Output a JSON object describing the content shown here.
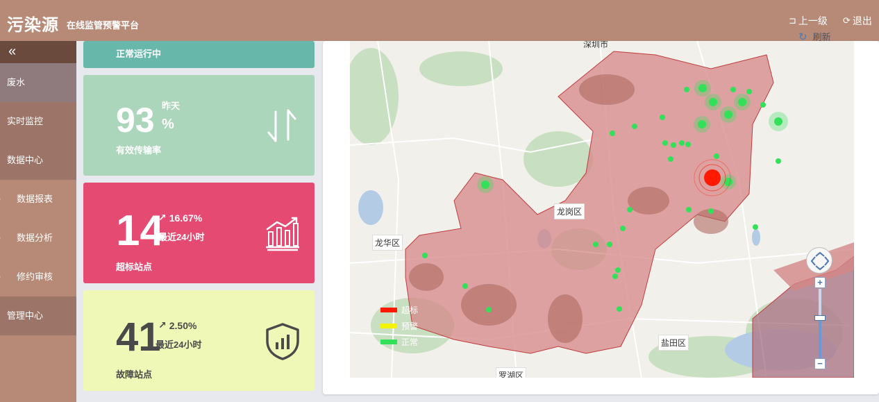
{
  "header": {
    "brand": "污染源",
    "subtitle": "在线监管预警平台",
    "back_label": "上一级",
    "logout_label": "退出",
    "refresh_label": "刷新"
  },
  "sidebar": {
    "collapse_icon": "double-chevron-left-icon",
    "items": [
      {
        "label": "废水",
        "level": "top",
        "state": "active"
      },
      {
        "label": "实时监控",
        "level": "top"
      },
      {
        "label": "数据中心",
        "level": "top"
      },
      {
        "label": "数据报表",
        "level": "sub"
      },
      {
        "label": "数据分析",
        "level": "sub"
      },
      {
        "label": "修约审核",
        "level": "sub"
      },
      {
        "label": "管理中心",
        "level": "top"
      }
    ]
  },
  "cards": {
    "running": {
      "label": "正常运行中",
      "color": "#67b8aa"
    },
    "transmission": {
      "value": "93",
      "top_text": "昨天",
      "unit": "%",
      "label": "有效传输率",
      "icon": "arrows-up-down-icon",
      "color": "#acd6bc"
    },
    "exceed": {
      "value": "14",
      "trend": "16.67%",
      "period": "最近24小时",
      "label": "超标站点",
      "icon": "chart-growth-icon",
      "color": "#e54b72"
    },
    "fault": {
      "value": "41",
      "trend": "2.50%",
      "period": "最近24小时",
      "label": "故障站点",
      "icon": "shield-chart-icon",
      "color": "#f0f8b7"
    }
  },
  "map": {
    "districts": [
      "深圳市",
      "龙岗区",
      "龙华区",
      "盐田区",
      "罗湖区"
    ],
    "legend": [
      {
        "label": "超标",
        "color": "#ff1a00"
      },
      {
        "label": "预警",
        "color": "#f4f400"
      },
      {
        "label": "正常",
        "color": "#33e05a"
      }
    ]
  }
}
